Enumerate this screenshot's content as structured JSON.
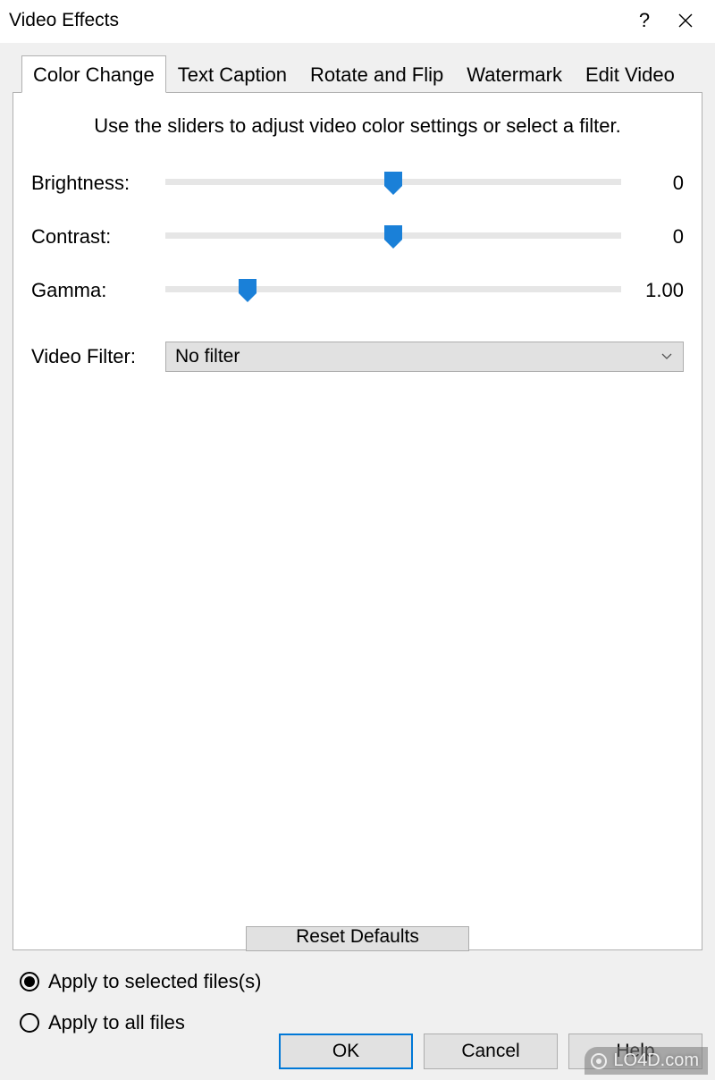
{
  "dialog": {
    "title": "Video Effects"
  },
  "tabs": [
    {
      "label": "Color Change",
      "active": true
    },
    {
      "label": "Text Caption",
      "active": false
    },
    {
      "label": "Rotate and Flip",
      "active": false
    },
    {
      "label": "Watermark",
      "active": false
    },
    {
      "label": "Edit Video",
      "active": false
    }
  ],
  "panel": {
    "instruction": "Use the sliders to adjust video color settings or select a filter.",
    "sliders": {
      "brightness": {
        "label": "Brightness:",
        "value_text": "0",
        "pct": 50
      },
      "contrast": {
        "label": "Contrast:",
        "value_text": "0",
        "pct": 50
      },
      "gamma": {
        "label": "Gamma:",
        "value_text": "1.00",
        "pct": 18
      }
    },
    "filter": {
      "label": "Video Filter:",
      "selected": "No filter"
    },
    "reset_label": "Reset Defaults"
  },
  "radios": {
    "selected": {
      "label": "Apply to selected files(s)",
      "checked": true
    },
    "all": {
      "label": "Apply to all files",
      "checked": false
    }
  },
  "buttons": {
    "ok": "OK",
    "cancel": "Cancel",
    "help": "Help"
  },
  "watermark": "LO4D.com",
  "colors": {
    "accent": "#1a80d8"
  }
}
